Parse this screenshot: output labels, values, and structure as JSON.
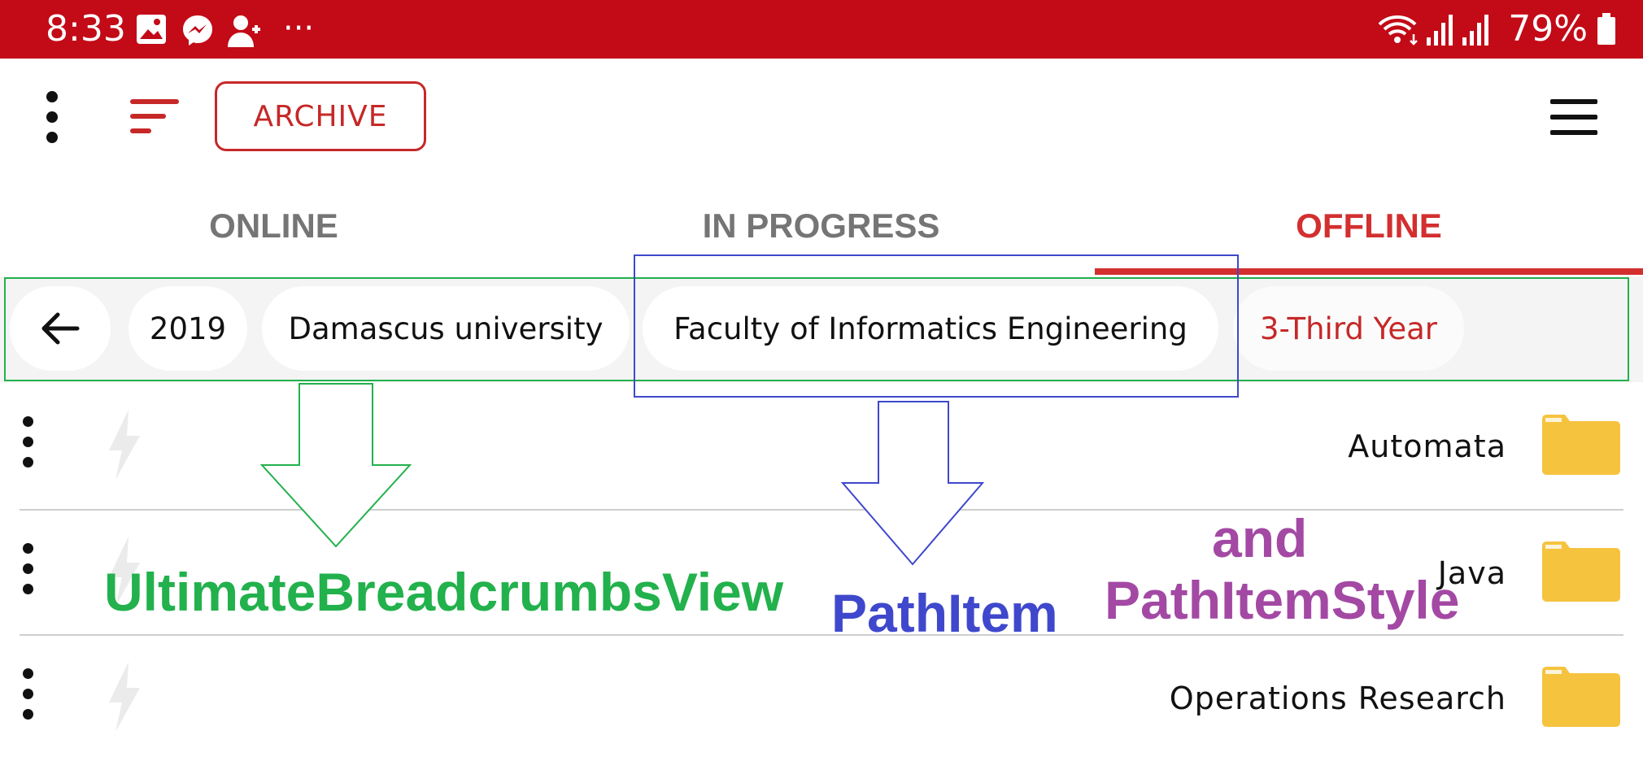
{
  "status_bar": {
    "time": "8:33",
    "icons": [
      "gallery-icon",
      "messenger-icon",
      "add-contact-icon",
      "more-notifications-icon",
      "wifi-icon",
      "signal-icon",
      "signal-icon",
      "battery-icon"
    ],
    "more_glyph": "···",
    "battery_percent": "79%",
    "background": "#c30a17"
  },
  "app_bar": {
    "overflow_icon": "vertical-dots-icon",
    "sort_icon": "sort-icon",
    "archive_label": "ARCHIVE",
    "menu_icon": "hamburger-icon"
  },
  "tabs": [
    {
      "label": "ONLINE",
      "active": false
    },
    {
      "label": "IN PROGRESS",
      "active": false
    },
    {
      "label": "OFFLINE",
      "active": true
    }
  ],
  "accent_color": "#d32f2f",
  "breadcrumbs": {
    "back_icon": "arrow-left-icon",
    "items": [
      {
        "label": "2019"
      },
      {
        "label": "Damascus university"
      },
      {
        "label": "Faculty of Informatics Engineering"
      },
      {
        "label": "3-Third Year",
        "current": true
      }
    ]
  },
  "list": {
    "items": [
      {
        "label": "Automata",
        "icon": "folder-icon"
      },
      {
        "label": "Java",
        "icon": "folder-icon"
      },
      {
        "label": "Operations Research",
        "icon": "folder-icon"
      }
    ],
    "folder_color": "#f6c33f"
  },
  "annotations": {
    "breadcrumbs_view": {
      "text": "UltimateBreadcrumbsView",
      "color": "#22b14c"
    },
    "path_item": {
      "text": "PathItem",
      "color": "#3f48cc"
    },
    "style_and": {
      "text": "and",
      "color": "#a349a4"
    },
    "path_item_style": {
      "text": "PathItemStyle",
      "color": "#a349a4"
    }
  }
}
